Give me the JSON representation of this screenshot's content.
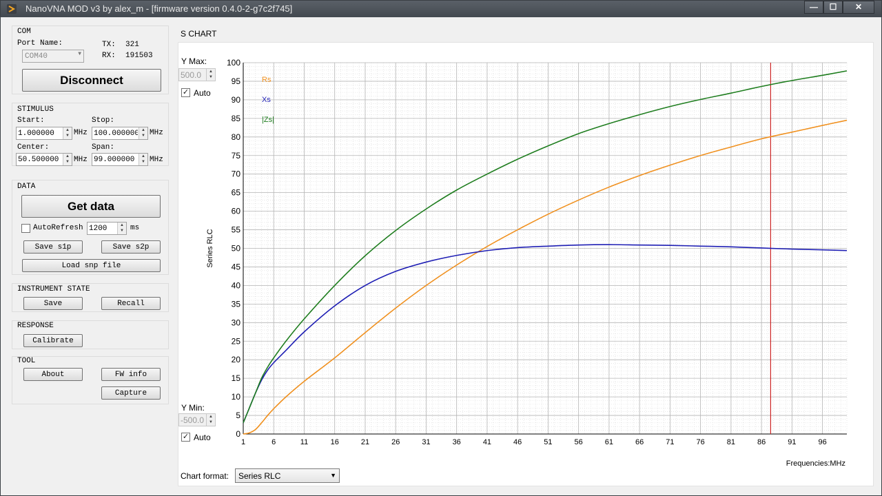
{
  "window": {
    "title": "NanoVNA MOD v3 by alex_m - [firmware version 0.4.0-2-g7c2f745]",
    "min_label": "—",
    "max_label": "☐",
    "close_label": "✕"
  },
  "com": {
    "title": "COM",
    "port_label": "Port Name:",
    "port_value": "COM40",
    "tx_label": "TX:",
    "tx_value": "321",
    "rx_label": "RX:",
    "rx_value": "191503",
    "disconnect_label": "Disconnect"
  },
  "stimulus": {
    "title": "STIMULUS",
    "start_label": "Start:",
    "start_value": "1.000000",
    "stop_label": "Stop:",
    "stop_value": "100.000000",
    "center_label": "Center:",
    "center_value": "50.500000",
    "span_label": "Span:",
    "span_value": "99.000000",
    "unit": "MHz"
  },
  "data_section": {
    "title": "DATA",
    "get_data_label": "Get data",
    "autorefresh_label": "AutoRefresh",
    "autorefresh_checked": false,
    "interval_value": "1200",
    "interval_unit": "ms",
    "save_s1p_label": "Save s1p",
    "save_s2p_label": "Save s2p",
    "load_snp_label": "Load snp file"
  },
  "instrument_state": {
    "title": "INSTRUMENT STATE",
    "save_label": "Save",
    "recall_label": "Recall"
  },
  "response": {
    "title": "RESPONSE",
    "calibrate_label": "Calibrate"
  },
  "tool": {
    "title": "TOOL",
    "about_label": "About",
    "fw_info_label": "FW info",
    "capture_label": "Capture"
  },
  "chart_panel": {
    "title": "S CHART",
    "ymax_label": "Y Max:",
    "ymax_value": "500.0",
    "ymax_auto_label": "Auto",
    "ymin_label": "Y Min:",
    "ymin_value": "-500.0",
    "ymin_auto_label": "Auto",
    "format_label": "Chart format:",
    "format_value": "Series RLC"
  },
  "chart_data": {
    "type": "line",
    "ylabel": "Series RLC",
    "xlabel": "Frequencies:MHz",
    "xlim": [
      1,
      100
    ],
    "ylim": [
      0,
      100
    ],
    "xticks": [
      1,
      6,
      11,
      16,
      21,
      26,
      31,
      36,
      41,
      46,
      51,
      56,
      61,
      66,
      71,
      76,
      81,
      86,
      91,
      96
    ],
    "yticks": [
      0,
      5,
      10,
      15,
      20,
      25,
      30,
      35,
      40,
      45,
      50,
      55,
      60,
      65,
      70,
      75,
      80,
      85,
      90,
      95,
      100
    ],
    "grid": true,
    "marker_x": 87.5,
    "marker_color": "#cc2222",
    "series": [
      {
        "name": "Rs",
        "color": "#f0901e",
        "x": [
          1,
          2,
          3,
          4,
          5,
          6,
          8,
          11,
          16,
          21,
          26,
          31,
          36,
          41,
          46,
          51,
          56,
          61,
          66,
          71,
          76,
          81,
          86,
          91,
          96,
          100
        ],
        "y": [
          0,
          0.3,
          1.2,
          3.0,
          5.0,
          6.8,
          10.0,
          14.2,
          20.5,
          27.3,
          33.9,
          40.0,
          45.5,
          50.5,
          55.0,
          59.2,
          63.0,
          66.5,
          69.6,
          72.4,
          75.0,
          77.3,
          79.5,
          81.3,
          83.1,
          84.5
        ]
      },
      {
        "name": "Xs",
        "color": "#1e1eb4",
        "x": [
          1,
          2,
          3,
          4,
          5,
          6,
          8,
          11,
          16,
          21,
          26,
          31,
          36,
          41,
          46,
          51,
          56,
          61,
          66,
          71,
          76,
          81,
          86,
          91,
          96,
          100
        ],
        "y": [
          3,
          7,
          11,
          14.5,
          17.2,
          19.2,
          22.5,
          27.5,
          34.5,
          40.0,
          43.8,
          46.3,
          48.1,
          49.4,
          50.2,
          50.6,
          50.9,
          51.0,
          50.9,
          50.8,
          50.6,
          50.4,
          50.1,
          49.8,
          49.6,
          49.4
        ]
      },
      {
        "name": "|Zs|",
        "color": "#1e7d1e",
        "x": [
          1,
          2,
          3,
          4,
          5,
          6,
          8,
          11,
          16,
          21,
          26,
          31,
          36,
          41,
          46,
          51,
          56,
          61,
          66,
          71,
          76,
          81,
          86,
          91,
          96,
          100
        ],
        "y": [
          3,
          7,
          11,
          15,
          18,
          20.5,
          25,
          31.0,
          40.0,
          48.0,
          54.8,
          60.6,
          65.7,
          70.0,
          74.0,
          77.6,
          80.9,
          83.6,
          86.0,
          88.2,
          90.1,
          91.8,
          93.6,
          95.2,
          96.6,
          97.8
        ]
      }
    ]
  }
}
